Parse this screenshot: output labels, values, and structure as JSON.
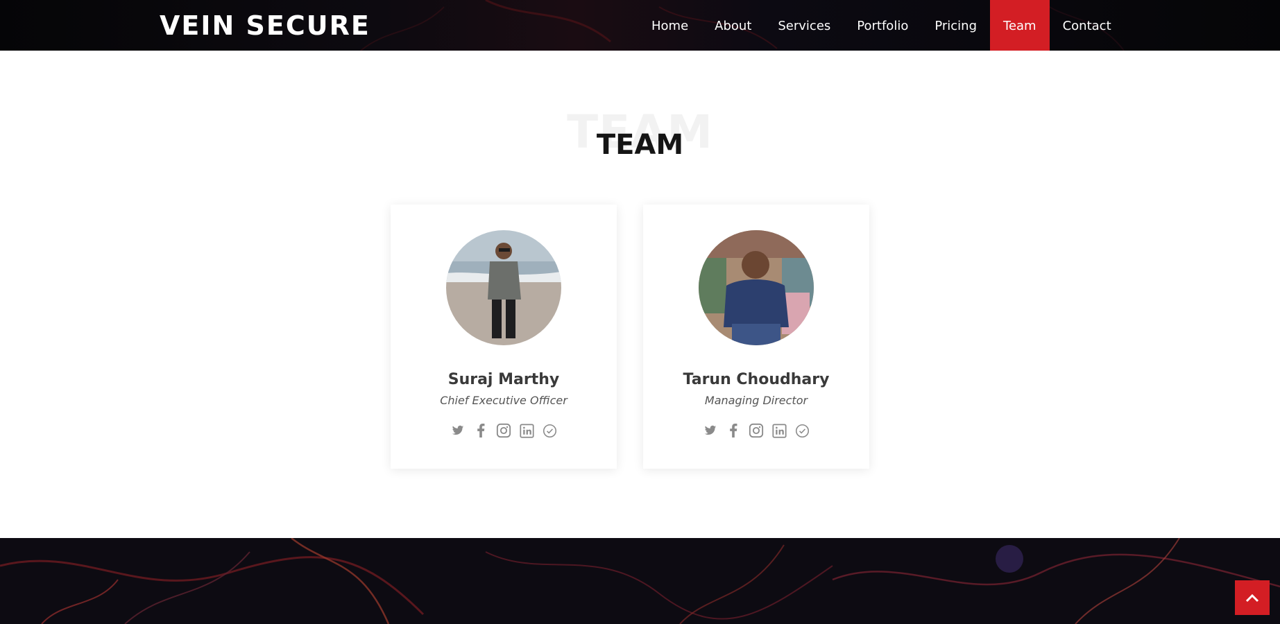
{
  "brand": {
    "name": "VEIN SECURE"
  },
  "nav": {
    "items": [
      {
        "label": "Home"
      },
      {
        "label": "About"
      },
      {
        "label": "Services"
      },
      {
        "label": "Portfolio"
      },
      {
        "label": "Pricing"
      },
      {
        "label": "Team",
        "active": true
      },
      {
        "label": "Contact"
      }
    ]
  },
  "section": {
    "title_background": "TEAM",
    "title": "TEAM"
  },
  "team": [
    {
      "name": "Suraj Marthy",
      "role": "Chief Executive Officer",
      "socials": [
        "twitter-icon",
        "facebook-icon",
        "instagram-icon",
        "linkedin-icon",
        "check-circle-icon"
      ]
    },
    {
      "name": "Tarun Choudhary",
      "role": "Managing Director",
      "socials": [
        "twitter-icon",
        "facebook-icon",
        "instagram-icon",
        "linkedin-icon",
        "check-circle-icon"
      ]
    }
  ],
  "colors": {
    "accent": "#d31e24",
    "header_bg": "#050507",
    "icon_gray": "#8a8a8a"
  }
}
